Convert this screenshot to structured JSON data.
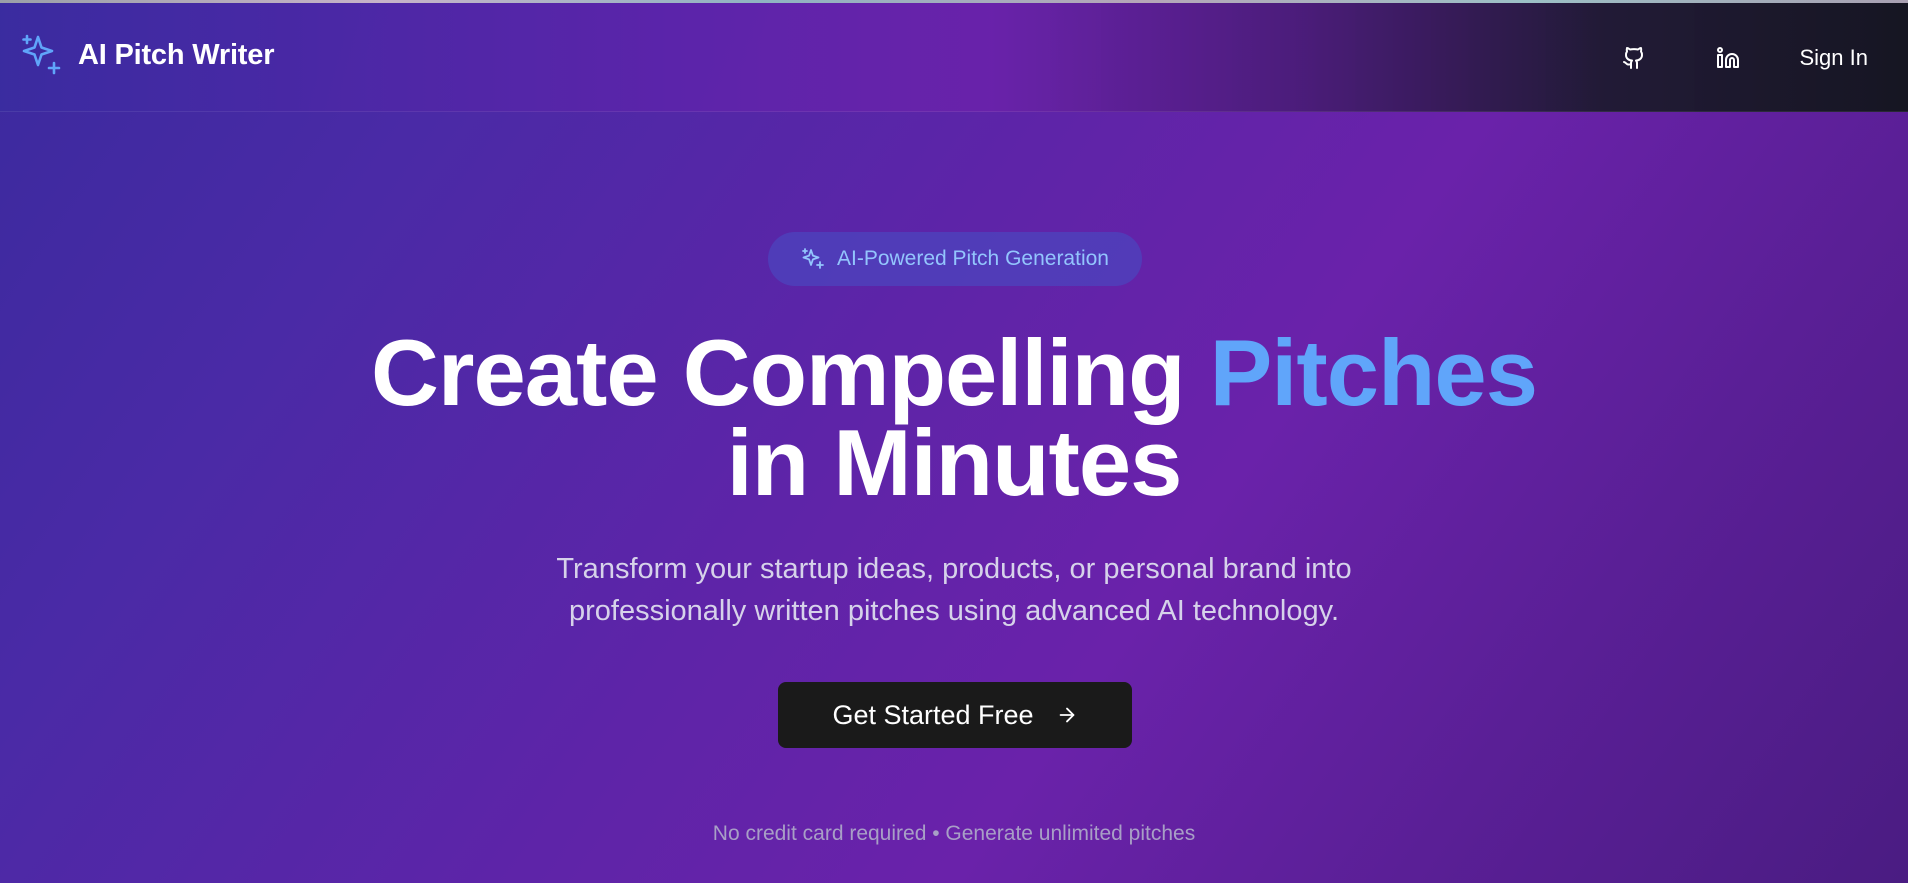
{
  "header": {
    "brand_icon": "sparkles-icon",
    "brand_title": "AI Pitch Writer",
    "github_icon": "github-icon",
    "linkedin_icon": "linkedin-icon",
    "signin_label": "Sign In"
  },
  "hero": {
    "badge_icon": "sparkles-icon",
    "badge_label": "AI-Powered Pitch Generation",
    "headline_part1": "Create Compelling ",
    "headline_accent": "Pitches",
    "headline_part2": "in Minutes",
    "subtitle_line1": "Transform your startup ideas, products, or personal brand into",
    "subtitle_line2": "professionally written pitches using advanced AI technology.",
    "cta_label": "Get Started Free",
    "cta_icon": "arrow-right-icon",
    "footnote": "No credit card required • Generate unlimited pitches"
  },
  "colors": {
    "accent": "#60a5fa",
    "cta_background": "#1a1a1a",
    "badge_text": "#93c5fd"
  }
}
